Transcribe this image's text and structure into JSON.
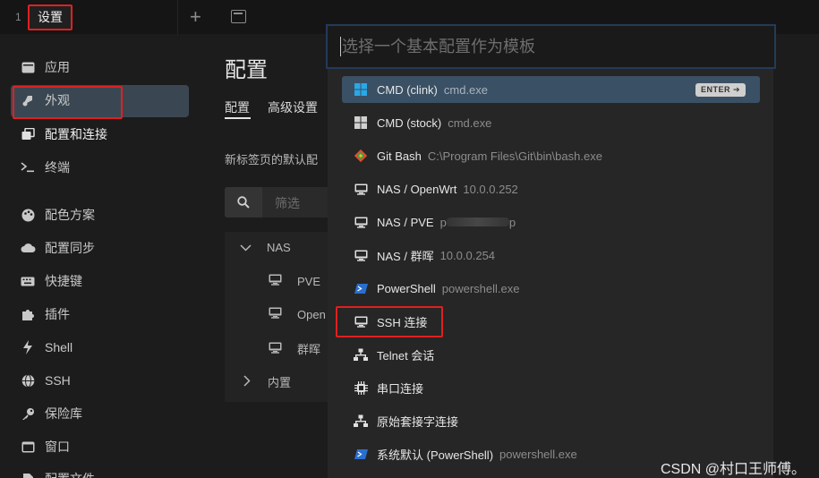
{
  "topbar": {
    "tab_number": "1",
    "tab_label": "设置",
    "new_tab": "+"
  },
  "sidebar": {
    "items": [
      {
        "label": "应用",
        "icon": "app-icon"
      },
      {
        "label": "外观",
        "icon": "appearance-icon"
      },
      {
        "label": "配置和连接",
        "icon": "profiles-icon"
      },
      {
        "label": "终端",
        "icon": "terminal-icon"
      },
      {
        "label": "配色方案",
        "icon": "palette-icon"
      },
      {
        "label": "配置同步",
        "icon": "cloud-icon"
      },
      {
        "label": "快捷键",
        "icon": "keyboard-icon"
      },
      {
        "label": "插件",
        "icon": "puzzle-icon"
      },
      {
        "label": "Shell",
        "icon": "bolt-icon"
      },
      {
        "label": "SSH",
        "icon": "globe-icon"
      },
      {
        "label": "保险库",
        "icon": "key-icon"
      },
      {
        "label": "窗口",
        "icon": "window-icon"
      },
      {
        "label": "配置文件",
        "icon": "file-icon"
      }
    ],
    "active_index": 2
  },
  "main": {
    "title": "配置",
    "tabs": [
      "配置",
      "高级设置"
    ],
    "description": "新标签页的默认配",
    "filter_placeholder": "筛选",
    "tree": {
      "group_nas": "NAS",
      "items": [
        "PVE",
        "Open",
        "群晖"
      ],
      "group_builtin": "内置"
    }
  },
  "dropdown": {
    "placeholder": "选择一个基本配置作为模板",
    "enter_label": "ENTER",
    "profiles": [
      {
        "name": "CMD (clink)",
        "desc": "cmd.exe",
        "icon": "windows-icon",
        "selected": true
      },
      {
        "name": "CMD (stock)",
        "desc": "cmd.exe",
        "icon": "windows-icon"
      },
      {
        "name": "Git Bash",
        "desc": "C:\\Program Files\\Git\\bin\\bash.exe",
        "icon": "git-icon"
      },
      {
        "name": "NAS / OpenWrt",
        "desc": "10.0.0.252",
        "icon": "monitor-icon"
      },
      {
        "name": "NAS / PVE",
        "desc": "p",
        "desc_tail": "p",
        "icon": "monitor-icon",
        "blurred": true
      },
      {
        "name": "NAS / 群晖",
        "desc": "10.0.0.254",
        "icon": "monitor-icon"
      },
      {
        "name": "PowerShell",
        "desc": "powershell.exe",
        "icon": "powershell-icon"
      },
      {
        "name": "SSH 连接",
        "desc": "",
        "icon": "monitor-icon"
      },
      {
        "name": "Telnet 会话",
        "desc": "",
        "icon": "network-icon"
      },
      {
        "name": "串口连接",
        "desc": "",
        "icon": "chip-icon"
      },
      {
        "name": "原始套接字连接",
        "desc": "",
        "icon": "network-icon"
      },
      {
        "name": "系统默认 (PowerShell)",
        "desc": "powershell.exe",
        "icon": "powershell-icon"
      }
    ]
  },
  "watermark": "CSDN @村口王师傅。",
  "colors": {
    "highlight_red": "#e02020",
    "selected_bg": "#3a5064",
    "active_sidebar_bg": "#3a4752"
  }
}
